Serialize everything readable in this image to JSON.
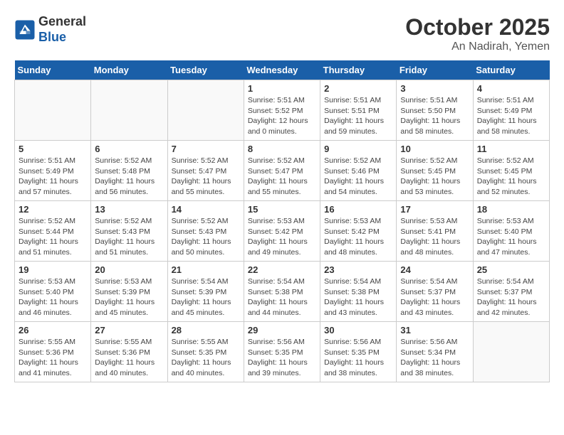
{
  "header": {
    "logo_line1": "General",
    "logo_line2": "Blue",
    "month": "October 2025",
    "location": "An Nadirah, Yemen"
  },
  "weekdays": [
    "Sunday",
    "Monday",
    "Tuesday",
    "Wednesday",
    "Thursday",
    "Friday",
    "Saturday"
  ],
  "weeks": [
    [
      {
        "day": "",
        "info": ""
      },
      {
        "day": "",
        "info": ""
      },
      {
        "day": "",
        "info": ""
      },
      {
        "day": "1",
        "info": "Sunrise: 5:51 AM\nSunset: 5:52 PM\nDaylight: 12 hours\nand 0 minutes."
      },
      {
        "day": "2",
        "info": "Sunrise: 5:51 AM\nSunset: 5:51 PM\nDaylight: 11 hours\nand 59 minutes."
      },
      {
        "day": "3",
        "info": "Sunrise: 5:51 AM\nSunset: 5:50 PM\nDaylight: 11 hours\nand 58 minutes."
      },
      {
        "day": "4",
        "info": "Sunrise: 5:51 AM\nSunset: 5:49 PM\nDaylight: 11 hours\nand 58 minutes."
      }
    ],
    [
      {
        "day": "5",
        "info": "Sunrise: 5:51 AM\nSunset: 5:49 PM\nDaylight: 11 hours\nand 57 minutes."
      },
      {
        "day": "6",
        "info": "Sunrise: 5:52 AM\nSunset: 5:48 PM\nDaylight: 11 hours\nand 56 minutes."
      },
      {
        "day": "7",
        "info": "Sunrise: 5:52 AM\nSunset: 5:47 PM\nDaylight: 11 hours\nand 55 minutes."
      },
      {
        "day": "8",
        "info": "Sunrise: 5:52 AM\nSunset: 5:47 PM\nDaylight: 11 hours\nand 55 minutes."
      },
      {
        "day": "9",
        "info": "Sunrise: 5:52 AM\nSunset: 5:46 PM\nDaylight: 11 hours\nand 54 minutes."
      },
      {
        "day": "10",
        "info": "Sunrise: 5:52 AM\nSunset: 5:45 PM\nDaylight: 11 hours\nand 53 minutes."
      },
      {
        "day": "11",
        "info": "Sunrise: 5:52 AM\nSunset: 5:45 PM\nDaylight: 11 hours\nand 52 minutes."
      }
    ],
    [
      {
        "day": "12",
        "info": "Sunrise: 5:52 AM\nSunset: 5:44 PM\nDaylight: 11 hours\nand 51 minutes."
      },
      {
        "day": "13",
        "info": "Sunrise: 5:52 AM\nSunset: 5:43 PM\nDaylight: 11 hours\nand 51 minutes."
      },
      {
        "day": "14",
        "info": "Sunrise: 5:52 AM\nSunset: 5:43 PM\nDaylight: 11 hours\nand 50 minutes."
      },
      {
        "day": "15",
        "info": "Sunrise: 5:53 AM\nSunset: 5:42 PM\nDaylight: 11 hours\nand 49 minutes."
      },
      {
        "day": "16",
        "info": "Sunrise: 5:53 AM\nSunset: 5:42 PM\nDaylight: 11 hours\nand 48 minutes."
      },
      {
        "day": "17",
        "info": "Sunrise: 5:53 AM\nSunset: 5:41 PM\nDaylight: 11 hours\nand 48 minutes."
      },
      {
        "day": "18",
        "info": "Sunrise: 5:53 AM\nSunset: 5:40 PM\nDaylight: 11 hours\nand 47 minutes."
      }
    ],
    [
      {
        "day": "19",
        "info": "Sunrise: 5:53 AM\nSunset: 5:40 PM\nDaylight: 11 hours\nand 46 minutes."
      },
      {
        "day": "20",
        "info": "Sunrise: 5:53 AM\nSunset: 5:39 PM\nDaylight: 11 hours\nand 45 minutes."
      },
      {
        "day": "21",
        "info": "Sunrise: 5:54 AM\nSunset: 5:39 PM\nDaylight: 11 hours\nand 45 minutes."
      },
      {
        "day": "22",
        "info": "Sunrise: 5:54 AM\nSunset: 5:38 PM\nDaylight: 11 hours\nand 44 minutes."
      },
      {
        "day": "23",
        "info": "Sunrise: 5:54 AM\nSunset: 5:38 PM\nDaylight: 11 hours\nand 43 minutes."
      },
      {
        "day": "24",
        "info": "Sunrise: 5:54 AM\nSunset: 5:37 PM\nDaylight: 11 hours\nand 43 minutes."
      },
      {
        "day": "25",
        "info": "Sunrise: 5:54 AM\nSunset: 5:37 PM\nDaylight: 11 hours\nand 42 minutes."
      }
    ],
    [
      {
        "day": "26",
        "info": "Sunrise: 5:55 AM\nSunset: 5:36 PM\nDaylight: 11 hours\nand 41 minutes."
      },
      {
        "day": "27",
        "info": "Sunrise: 5:55 AM\nSunset: 5:36 PM\nDaylight: 11 hours\nand 40 minutes."
      },
      {
        "day": "28",
        "info": "Sunrise: 5:55 AM\nSunset: 5:35 PM\nDaylight: 11 hours\nand 40 minutes."
      },
      {
        "day": "29",
        "info": "Sunrise: 5:56 AM\nSunset: 5:35 PM\nDaylight: 11 hours\nand 39 minutes."
      },
      {
        "day": "30",
        "info": "Sunrise: 5:56 AM\nSunset: 5:35 PM\nDaylight: 11 hours\nand 38 minutes."
      },
      {
        "day": "31",
        "info": "Sunrise: 5:56 AM\nSunset: 5:34 PM\nDaylight: 11 hours\nand 38 minutes."
      },
      {
        "day": "",
        "info": ""
      }
    ]
  ]
}
